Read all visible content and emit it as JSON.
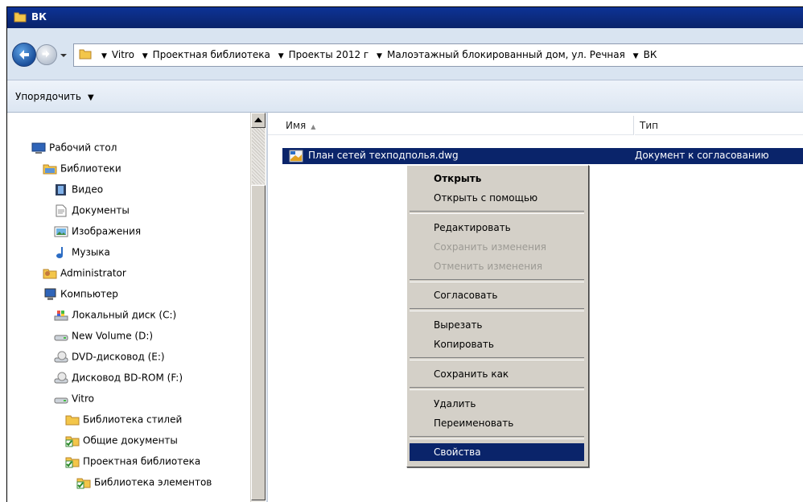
{
  "window": {
    "title": "ВК"
  },
  "address": {
    "crumbs": [
      "Vitro",
      "Проектная библиотека",
      "Проекты 2012 г",
      "Малоэтажный блокированный дом, ул. Речная",
      "ВК"
    ]
  },
  "toolbar": {
    "organize_label": "Упорядочить"
  },
  "nav": {
    "items": [
      {
        "label": "Рабочий стол",
        "icon": "desktop-icon"
      },
      {
        "label": "Библиотеки",
        "icon": "libraries-icon"
      },
      {
        "label": "Видео",
        "icon": "video-icon"
      },
      {
        "label": "Документы",
        "icon": "documents-icon"
      },
      {
        "label": "Изображения",
        "icon": "pictures-icon"
      },
      {
        "label": "Музыка",
        "icon": "music-icon"
      },
      {
        "label": "Administrator",
        "icon": "user-folder-icon"
      },
      {
        "label": "Компьютер",
        "icon": "computer-icon"
      },
      {
        "label": "Локальный диск (C:)",
        "icon": "system-drive-icon"
      },
      {
        "label": "New Volume (D:)",
        "icon": "drive-icon"
      },
      {
        "label": "DVD-дисковод (E:)",
        "icon": "dvd-drive-icon"
      },
      {
        "label": "Дисковод BD-ROM (F:)",
        "icon": "bd-drive-icon"
      },
      {
        "label": "Vitro",
        "icon": "network-drive-icon"
      },
      {
        "label": "Библиотека стилей",
        "icon": "folder-icon"
      },
      {
        "label": "Общие документы",
        "icon": "checked-folder-icon"
      },
      {
        "label": "Проектная библиотека",
        "icon": "checked-folder-icon"
      },
      {
        "label": "Библиотека элементов",
        "icon": "checked-folder-icon"
      }
    ]
  },
  "list": {
    "columns": {
      "name": "Имя",
      "type": "Тип"
    },
    "files": [
      {
        "name": "План сетей техподполья.dwg",
        "type": "Документ к согласованию"
      }
    ]
  },
  "context_menu": {
    "items": [
      {
        "label": "Открыть",
        "bold": true
      },
      {
        "label": "Открыть с помощью"
      },
      {
        "label": "Редактировать"
      },
      {
        "label": "Сохранить изменения",
        "disabled": true
      },
      {
        "label": "Отменить изменения",
        "disabled": true
      },
      {
        "label": "Согласовать"
      },
      {
        "label": "Вырезать"
      },
      {
        "label": "Копировать"
      },
      {
        "label": "Сохранить как"
      },
      {
        "label": "Удалить"
      },
      {
        "label": "Переименовать"
      },
      {
        "label": "Свойства",
        "highlighted": true
      }
    ]
  },
  "colors": {
    "titlebar": "#0a246a",
    "selection": "#0a246a",
    "menu_background": "#d4d0c8",
    "address_background": "#d9e4f1"
  }
}
